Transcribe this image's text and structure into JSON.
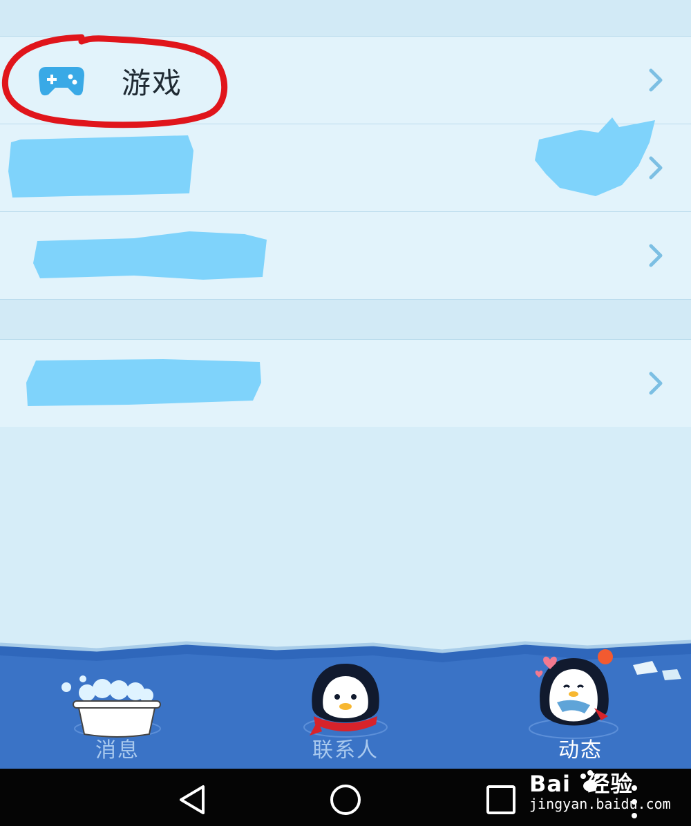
{
  "menu": {
    "rows": [
      {
        "label": "游戏",
        "icon": "gamepad-icon"
      }
    ],
    "chevron_icon": "chevron-right-icon"
  },
  "tabbar": {
    "tabs": [
      {
        "label": "消息",
        "icon": "bathtub-icon",
        "active": false
      },
      {
        "label": "联系人",
        "icon": "penguin-icon",
        "active": false
      },
      {
        "label": "动态",
        "icon": "penguin-with-fish-icon",
        "active": true,
        "badge_dot": true
      }
    ]
  },
  "navbar": {
    "buttons": [
      "back-icon",
      "home-icon",
      "recent-apps-icon"
    ]
  },
  "watermark": {
    "main": "Bai  经验",
    "sub": "jingyan.baidu.com"
  },
  "colors": {
    "accent_blue": "#39a9e6",
    "annotation_red": "#e0151b",
    "tabbar_blue": "#3a73c6",
    "redaction_blue": "#7fd3fb"
  }
}
